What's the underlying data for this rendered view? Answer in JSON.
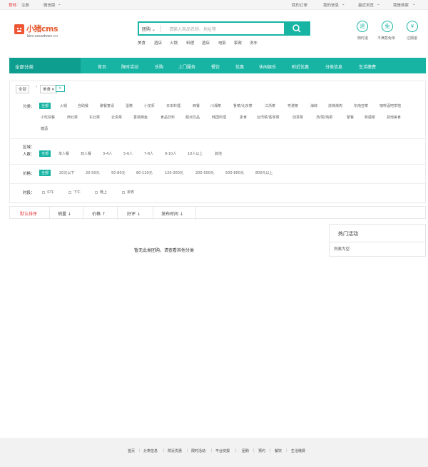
{
  "topbar": {
    "login": "登陆",
    "register": "注册",
    "wechat": "微信版",
    "my_orders": "我的订单",
    "my_info": "我的信息",
    "recent": "最近浏览",
    "merchant": "我是商家"
  },
  "logo": {
    "name": "小猪cms",
    "sub": "bbs.sasadown.cn"
  },
  "search": {
    "category": "团购",
    "placeholder": "请输入商品名称、地址等",
    "hot": [
      "美食",
      "酒店",
      "火锅",
      "料理",
      "酒店",
      "电影",
      "家政",
      "洗车"
    ]
  },
  "badges": [
    {
      "glyph": "退",
      "label": "随时退"
    },
    {
      "glyph": "免",
      "label": "不满意免单"
    },
    {
      "glyph": "¥",
      "label": "过期退"
    }
  ],
  "nav": {
    "all": "全部分类",
    "items": [
      "首页",
      "限时活动",
      "乐购",
      "上门服务",
      "餐饮",
      "优惠",
      "休闲娱乐",
      "附近优惠",
      "分类信息",
      "生活缴费"
    ]
  },
  "crumbs": {
    "all": "全部",
    "current": "美食",
    "close": "×"
  },
  "filter": {
    "category_label": "分类：",
    "categories_row1": [
      "全部",
      "火锅",
      "自助餐",
      "聚餐宴请",
      "蛋糕",
      "小龙虾",
      "日本料理",
      "西餐",
      "川湘菜",
      "鲁菜/北京菜",
      "江浙菜",
      "粤港菜",
      "海鲜",
      "烧烤烤肉",
      "东南亚菜",
      "咖啡酒吧茶馆"
    ],
    "categories_row2": [
      "小吃快餐",
      "西北菜",
      "东北菜",
      "云贵菜",
      "香锅烤鱼",
      "食品饮料",
      "甜点饮品",
      "韩国料理",
      "素食",
      "台湾菜/客家菜",
      "创意菜",
      "汤/粥/炖菜",
      "蒙餐",
      "新疆菜",
      "其他美食"
    ],
    "categories_row3": [
      "糖酒"
    ],
    "area_label": "区域：",
    "people_label": "人数：",
    "people": [
      "全部",
      "单人餐",
      "双人餐",
      "3-4人",
      "5-6人",
      "7-8人",
      "9-10人",
      "10人以上",
      "其他"
    ],
    "price_label": "价格：",
    "prices": [
      "全部",
      "20元以下",
      "20-50元",
      "50-80元",
      "80-120元",
      "120-200元",
      "200-500元",
      "500-800元",
      "800元以上"
    ],
    "time_label": "时段：",
    "times": [
      "中午",
      "下午",
      "晚上",
      "夜宵"
    ]
  },
  "sort": [
    "默认排序",
    "销量 ↓",
    "价格 ↑",
    "好评 ↓",
    "发布时间 ↓"
  ],
  "empty_text": "暂无此类团购，请查看其他分类",
  "hot_box": {
    "title": "热门活动",
    "empty": "列表为空"
  },
  "footer": [
    "首页",
    "|",
    "分类信息",
    "|",
    "附近优惠",
    "|",
    "限时活动",
    "|",
    "平台快报",
    "|",
    "团购",
    "|",
    "预约",
    "|",
    "餐饮",
    "|",
    "生活缴费"
  ],
  "colors": {
    "accent": "#17b4a4",
    "brand": "#e65b30",
    "link_red": "#e4393c"
  }
}
